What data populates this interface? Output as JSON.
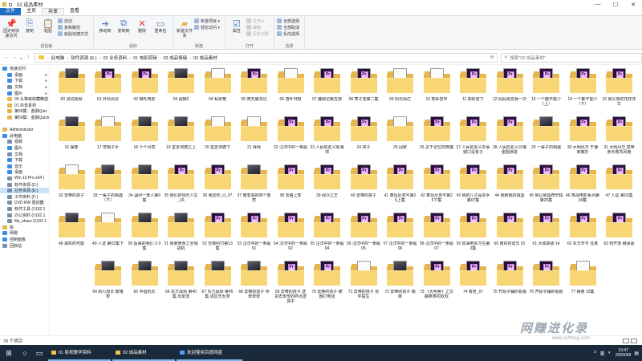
{
  "window": {
    "title": "02 成品素材",
    "controls": [
      "—",
      "☐",
      "✕"
    ]
  },
  "ribbon_tabs": [
    "文件",
    "主页",
    "共享",
    "查看"
  ],
  "ribbon_groups": [
    {
      "label": "剪贴板",
      "big": [
        {
          "icon": "pin-icon",
          "label": "固定到快速访问"
        },
        {
          "icon": "copy-icon",
          "label": "复制"
        },
        {
          "icon": "paste-icon",
          "label": "粘贴"
        }
      ],
      "small": [
        {
          "label": "剪切",
          "disabled": false
        },
        {
          "label": "复制路径",
          "disabled": false
        },
        {
          "label": "粘贴快捷方式",
          "disabled": false
        }
      ]
    },
    {
      "label": "组织",
      "big": [
        {
          "icon": "move-icon",
          "label": "移动到"
        },
        {
          "icon": "copy-to-icon",
          "label": "复制到"
        },
        {
          "icon": "delete-icon",
          "label": "删除"
        },
        {
          "icon": "rename-icon",
          "label": "重命名"
        }
      ],
      "small": []
    },
    {
      "label": "新建",
      "big": [
        {
          "icon": "new-folder-icon",
          "label": "新建文件夹"
        }
      ],
      "small": [
        {
          "label": "新建项目 ▾",
          "disabled": false
        },
        {
          "label": "轻松访问 ▾",
          "disabled": false
        }
      ]
    },
    {
      "label": "打开",
      "big": [
        {
          "icon": "properties-icon",
          "label": "属性"
        }
      ],
      "small": [
        {
          "label": "打开 ▾",
          "disabled": true
        },
        {
          "label": "编辑",
          "disabled": true
        },
        {
          "label": "历史记录",
          "disabled": true
        }
      ]
    },
    {
      "label": "选择",
      "big": [],
      "small": [
        {
          "label": "全部选择",
          "disabled": false
        },
        {
          "label": "全部取消",
          "disabled": false
        },
        {
          "label": "反向选择",
          "disabled": false
        }
      ]
    }
  ],
  "address": {
    "crumbs": [
      "此电脑",
      "软件资源 (E:)",
      "02 业务资料",
      "01 电影剪辑",
      "02 成品情绪",
      "02 成品素材"
    ],
    "search_placeholder": "搜索\"02 成品素材\""
  },
  "nav_items": [
    {
      "label": "快速访问",
      "icon": "star-icon",
      "color": "#3c8ce7",
      "sel": false,
      "pin": false
    },
    {
      "label": "桌面",
      "icon": "desktop-icon",
      "color": "#3c8ce7",
      "sel": false,
      "pin": true
    },
    {
      "label": "下载",
      "icon": "download-icon",
      "color": "#3c8ce7",
      "sel": false,
      "pin": true
    },
    {
      "label": "文档",
      "icon": "document-icon",
      "color": "#7a8fa8",
      "sel": false,
      "pin": true
    },
    {
      "label": "图片",
      "icon": "picture-icon",
      "color": "#3c8ce7",
      "sel": false,
      "pin": true
    },
    {
      "label": "00 头等级收藏精选",
      "icon": "folder-icon",
      "color": "#e8b54a",
      "sel": false,
      "pin": false
    },
    {
      "label": "01 抖音素材",
      "icon": "folder-icon",
      "color": "#e8b54a",
      "sel": false,
      "pin": false
    },
    {
      "label": "第56集：金融Quic",
      "icon": "folder-icon",
      "color": "#e8b54a",
      "sel": false,
      "pin": false
    },
    {
      "label": "第59集：金融Quick",
      "icon": "folder-icon",
      "color": "#e8b54a",
      "sel": false,
      "pin": false
    },
    {
      "label": "",
      "icon": "spacer",
      "color": "transparent",
      "sel": false,
      "pin": false
    },
    {
      "label": "Administrator",
      "icon": "user-icon",
      "color": "#e8b54a",
      "sel": false,
      "pin": false
    },
    {
      "label": "此电脑",
      "icon": "pc-icon",
      "color": "#3c8ce7",
      "sel": false,
      "pin": false
    },
    {
      "label": "视频",
      "icon": "video-icon",
      "color": "#7a8fa8",
      "sel": false,
      "pin": false
    },
    {
      "label": "图片",
      "icon": "picture-icon",
      "color": "#3c8ce7",
      "sel": false,
      "pin": false
    },
    {
      "label": "文档",
      "icon": "document-icon",
      "color": "#7a8fa8",
      "sel": false,
      "pin": false
    },
    {
      "label": "下载",
      "icon": "download-icon",
      "color": "#3c8ce7",
      "sel": false,
      "pin": false
    },
    {
      "label": "音乐",
      "icon": "music-icon",
      "color": "#3c8ce7",
      "sel": false,
      "pin": false
    },
    {
      "label": "桌面",
      "icon": "desktop-icon",
      "color": "#3c8ce7",
      "sel": false,
      "pin": false
    },
    {
      "label": "Win 10 Pro x64 (",
      "icon": "drive-icon",
      "color": "#7a8fa8",
      "sel": false,
      "pin": false
    },
    {
      "label": "软件资源 (D:)",
      "icon": "drive-icon",
      "color": "#7a8fa8",
      "sel": false,
      "pin": false
    },
    {
      "label": "业务资源 (E:)",
      "icon": "drive-icon",
      "color": "#7a8fa8",
      "sel": true,
      "pin": false
    },
    {
      "label": "工作资料 (F:)",
      "icon": "drive-icon",
      "color": "#7a8fa8",
      "sel": false,
      "pin": false
    },
    {
      "label": "DVD RW 驱动器",
      "icon": "dvd-icon",
      "color": "#7a8fa8",
      "sel": false,
      "pin": false
    },
    {
      "label": "软件工具 (\\\\192.1",
      "icon": "network-drive-icon",
      "color": "#7a8fa8",
      "sel": false,
      "pin": false
    },
    {
      "label": "办公资料 (\\\\192.1",
      "icon": "network-drive-icon",
      "color": "#7a8fa8",
      "sel": false,
      "pin": false
    },
    {
      "label": "file_share (\\\\192.1",
      "icon": "network-drive-icon",
      "color": "#7a8fa8",
      "sel": false,
      "pin": false
    },
    {
      "label": "库",
      "icon": "library-icon",
      "color": "#e8b54a",
      "sel": false,
      "pin": false
    },
    {
      "label": "网络",
      "icon": "network-icon",
      "color": "#3c8ce7",
      "sel": false,
      "pin": false
    },
    {
      "label": "控制面板",
      "icon": "control-panel-icon",
      "color": "#3c8ce7",
      "sel": false,
      "pin": false
    },
    {
      "label": "回收站",
      "icon": "recycle-bin-icon",
      "color": "#7a8fa8",
      "sel": false,
      "pin": false
    }
  ],
  "folders": [
    "00 测试视频",
    "01 外科风云",
    "02 哪吒电影",
    "03 战狼2",
    "04 私房格",
    "05 倚天屠龙记",
    "06 落叶归根",
    "07 鹿鼎记第五部",
    "08 寒江雪第二集",
    "09 阳光灿烂",
    "10 郭彩音中",
    "11 郭彩音下",
    "12 妈妈再爱我一次",
    "13 一个都不能少（上）",
    "14 一个都不能少（下）",
    "15 我父亲的花样年华",
    "16 摆要",
    "17 草帽子手",
    "18 十个月亮",
    "19 堂吉诃德之上",
    "20 堂吉诃德下",
    "21 拜拜",
    "22 汪洋中的一条船",
    "23 人民的名义陈海郊",
    "24 饼子",
    "25 回家",
    "26 关于记忆的熊猫",
    "27 人民的名义办事窗口没有子",
    "28 人民的名义沙瑞金阻挡进",
    "29 一辈子的相遇",
    "30 大明风华 于谦家被抄",
    "31 大明风华 皇帝亲手救驾风雨",
    "32 去带的孩子",
    "33 一辈子的相遇（下）",
    "34 温州一家人第9集",
    "35 我们的快乐人生_16",
    "36 我爱你_cl_07",
    "37 雨季来的四个慈悲",
    "38 去路上季",
    "39 砚沙之王",
    "40 去带的孩子",
    "41 泰坦尼克号第26上集",
    "42 泰坦尼克号第26下集",
    "43 我的儿子是杀手 第07集",
    "44 我和我的祖国",
    "45 我以我血荐轩辕第25集",
    "46 寒战电影系列第34集",
    "47 人证 第02集",
    "48 诚实的可能",
    "49 人证 第02集下",
    "50 后来的我们 2-3集",
    "51 我要使命之全城战机",
    "52 空降利刃第13集",
    "53 汪洋中的一条船 01",
    "54 汪洋中的一条船 02",
    "55 汪洋中的一条船 04",
    "56 汪洋中的一条船 05",
    "57 汪洋中的一条船 06",
    "58 汪洋中的一条船 07",
    "59 加油吧实习生第2集",
    "60 南好的遗忘 01",
    "61 大成高级 14",
    "62 东方年号 任真",
    "63 热开放 继承嘉",
    "",
    "64 执行局长 鞍魂校",
    "65 中国机长",
    "66 东方战场 第40集 出京流",
    "67 东方战场 第45集 逃区年女尧",
    "68 去带的孩子 夺母母母",
    "69 去带的孩子 送货去宋母的终点送货中",
    "70 去带的孩子 被困打电话",
    "71 去带的孩子 冒宇医生",
    "72 去带的孩子 瑞审",
    "73 《大明宫》之文静笑笑的欢欢",
    "74 香皂_07",
    "75 开始子辅的看报",
    "76 开始子辅的看报",
    "77 摆要 10集"
  ],
  "status": {
    "count": "78 个项目"
  },
  "taskbar": {
    "apps": [
      "01 影视教学资料",
      "02 成品素材",
      "欢迎使用百度网盘"
    ],
    "time": "13:47",
    "date": "2020/4/9"
  },
  "watermark": {
    "line1": "网赚进化录",
    "line2": "www.52thing.com"
  }
}
